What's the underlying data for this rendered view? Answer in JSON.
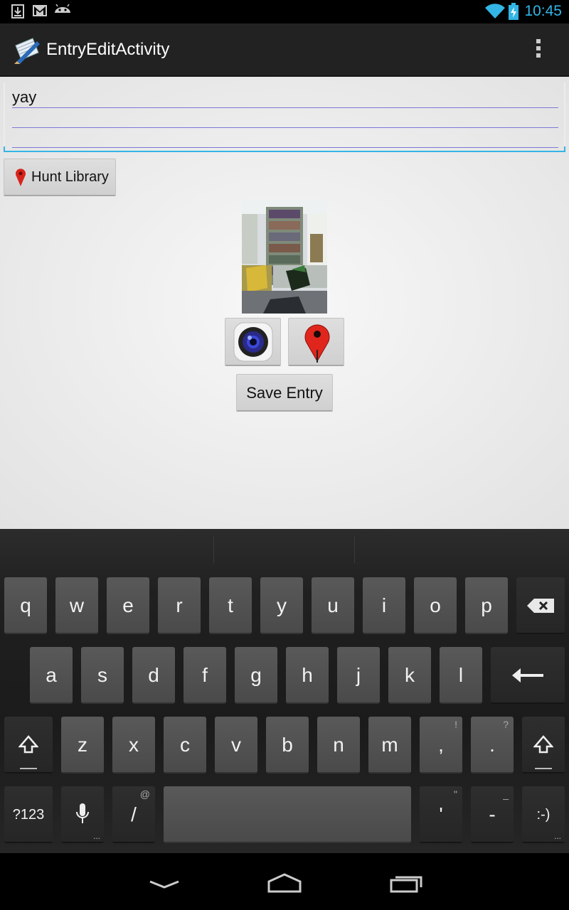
{
  "status_bar": {
    "time": "10:45",
    "icons": [
      "download-icon",
      "gmail-icon",
      "android-icon",
      "wifi-icon",
      "battery-charging-icon"
    ]
  },
  "action_bar": {
    "title": "EntryEditActivity",
    "menu_icon": "overflow-menu-icon"
  },
  "form": {
    "entry_text": "yay",
    "location_label": "Hunt Library",
    "photo_description": "library-photo",
    "save_label": "Save Entry"
  },
  "keyboard": {
    "row1": [
      "q",
      "w",
      "e",
      "r",
      "t",
      "y",
      "u",
      "i",
      "o",
      "p"
    ],
    "row2": [
      "a",
      "s",
      "d",
      "f",
      "g",
      "h",
      "j",
      "k",
      "l"
    ],
    "row3": [
      "z",
      "x",
      "c",
      "v",
      "b",
      "n",
      "m",
      ",",
      "."
    ],
    "row3_hints": {
      ",": "!",
      ".": "?"
    },
    "bottom": {
      "symbols": "?123",
      "slash": "/",
      "slash_hint": "@",
      "apostrophe": "'",
      "apostrophe_hint": "\"",
      "dash": "-",
      "dash_hint": "_",
      "smiley": ":-)"
    }
  },
  "nav_bar": {
    "buttons": [
      "back-icon",
      "home-icon",
      "recent-apps-icon"
    ]
  }
}
